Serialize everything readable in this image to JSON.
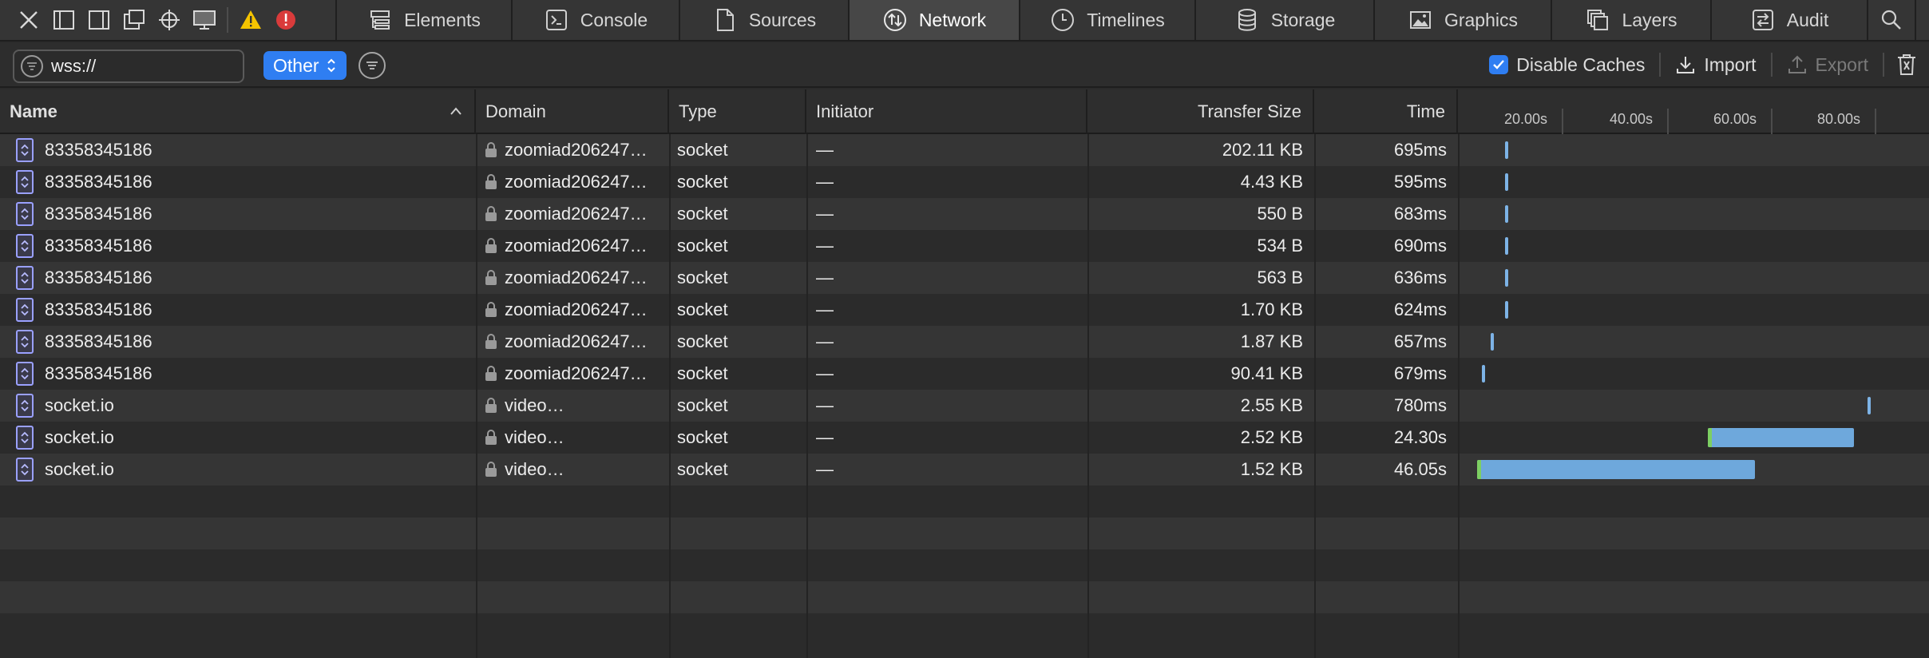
{
  "tabs": [
    {
      "label": "Elements",
      "icon": "elements-icon"
    },
    {
      "label": "Console",
      "icon": "console-icon"
    },
    {
      "label": "Sources",
      "icon": "sources-icon"
    },
    {
      "label": "Network",
      "icon": "network-icon",
      "active": true
    },
    {
      "label": "Timelines",
      "icon": "timelines-icon"
    },
    {
      "label": "Storage",
      "icon": "storage-icon"
    },
    {
      "label": "Graphics",
      "icon": "graphics-icon"
    },
    {
      "label": "Layers",
      "icon": "layers-icon"
    },
    {
      "label": "Audit",
      "icon": "audit-icon"
    }
  ],
  "filter": {
    "search_value": "wss://",
    "type_selected": "Other",
    "disable_caches_label": "Disable Caches",
    "disable_caches_checked": true,
    "import_label": "Import",
    "export_label": "Export"
  },
  "columns": {
    "name": "Name",
    "domain": "Domain",
    "type": "Type",
    "initiator": "Initiator",
    "transfer_size": "Transfer Size",
    "time": "Time"
  },
  "timeline_ticks": [
    "20.00s",
    "40.00s",
    "60.00s",
    "80.00s"
  ],
  "colors": {
    "accent": "#2f7ef2",
    "bar": "#6ea8dc",
    "wait": "#7dcf62",
    "warning": "#f5c400",
    "error": "#d93b3b"
  },
  "rows": [
    {
      "name": "83358345186",
      "domain": "zoomiad206247…",
      "type": "socket",
      "initiator": "—",
      "size": "202.11 KB",
      "time": "695ms",
      "start": 0.1
    },
    {
      "name": "83358345186",
      "domain": "zoomiad206247…",
      "type": "socket",
      "initiator": "—",
      "size": "4.43 KB",
      "time": "595ms",
      "start": 0.1
    },
    {
      "name": "83358345186",
      "domain": "zoomiad206247…",
      "type": "socket",
      "initiator": "—",
      "size": "550 B",
      "time": "683ms",
      "start": 0.1
    },
    {
      "name": "83358345186",
      "domain": "zoomiad206247…",
      "type": "socket",
      "initiator": "—",
      "size": "534 B",
      "time": "690ms",
      "start": 0.1
    },
    {
      "name": "83358345186",
      "domain": "zoomiad206247…",
      "type": "socket",
      "initiator": "—",
      "size": "563 B",
      "time": "636ms",
      "start": 0.1
    },
    {
      "name": "83358345186",
      "domain": "zoomiad206247…",
      "type": "socket",
      "initiator": "—",
      "size": "1.70 KB",
      "time": "624ms",
      "start": 0.1
    },
    {
      "name": "83358345186",
      "domain": "zoomiad206247…",
      "type": "socket",
      "initiator": "—",
      "size": "1.87 KB",
      "time": "657ms",
      "start": 0.07
    },
    {
      "name": "83358345186",
      "domain": "zoomiad206247…",
      "type": "socket",
      "initiator": "—",
      "size": "90.41 KB",
      "time": "679ms",
      "start": 0.05
    },
    {
      "name": "socket.io",
      "domain": "video…",
      "type": "socket",
      "initiator": "—",
      "size": "2.55 KB",
      "time": "780ms",
      "start": 0.87
    },
    {
      "name": "socket.io",
      "domain": "video…",
      "type": "socket",
      "initiator": "—",
      "size": "2.52 KB",
      "time": "24.30s",
      "start": 0.53,
      "width": 0.31
    },
    {
      "name": "socket.io",
      "domain": "video…",
      "type": "socket",
      "initiator": "—",
      "size": "1.52 KB",
      "time": "46.05s",
      "start": 0.04,
      "width": 0.59
    }
  ]
}
